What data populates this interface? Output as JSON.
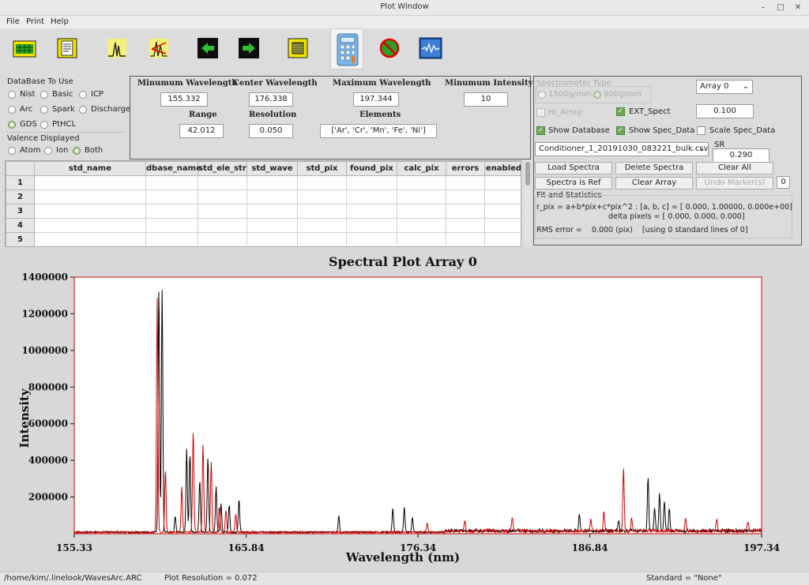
{
  "window": {
    "title": "Plot Window"
  },
  "menu": {
    "file": "File",
    "print": "Print",
    "help": "Help"
  },
  "toolbar": {
    "icons": [
      "database-icon",
      "notes-icon",
      "spectrum-peaks-icon",
      "spectrum-compare-icon",
      "arrow-left-icon",
      "arrow-right-icon",
      "square-frame-icon",
      "calculator-icon",
      "no-entry-icon",
      "waveform-monitor-icon"
    ]
  },
  "database": {
    "title": "DataBase To Use",
    "options": [
      "Nist",
      "Basic",
      "ICP",
      "Arc",
      "Spark",
      "Discharge",
      "GDS",
      "PtHCL"
    ],
    "selected": "GDS"
  },
  "valence": {
    "title": "Valence Displayed",
    "options": [
      "Atom",
      "Ion",
      "Both"
    ],
    "selected": "Both"
  },
  "params": {
    "min_wavelength_label": "Minumum Wavelength",
    "min_wavelength": "155.332",
    "center_wavelength_label": "Center Wavelength",
    "center_wavelength": "176.338",
    "max_wavelength_label": "Maximum Wavelength",
    "max_wavelength": "197.344",
    "min_intensity_label": "Minumum Intensity",
    "min_intensity": "10",
    "range_label": "Range",
    "range": "42.012",
    "resolution_label": "Resolution",
    "resolution": "0.050",
    "elements_label": "Elements",
    "elements": "['Ar', 'Cr', 'Mn', 'Fe', 'Ni']"
  },
  "table": {
    "columns": [
      "std_name",
      "dbase_name",
      "std_ele_str",
      "std_wave",
      "std_pix",
      "found_pix",
      "calc_pix",
      "errors",
      "enabled"
    ],
    "row_numbers": [
      "1",
      "2",
      "3",
      "4",
      "5"
    ]
  },
  "right_panel": {
    "spectrometer_type_label": "Spectrometer Type",
    "grating_1500": "1500g/mm",
    "grating_900": "900g/mm",
    "array_select": "Array 0",
    "hi_array": "Hi_Array:",
    "ext_spect": "EXT_Spect",
    "ext_spect_value": "0.100",
    "show_database": "Show Database",
    "show_spec_data": "Show Spec_Data",
    "scale_spec_data": "Scale Spec_Data",
    "file_select": "Conditioner_1_20191030_083221_bulk.csv",
    "sr_label": "SR",
    "sr_value": "0.290",
    "load_spectra": "Load Spectra",
    "delete_spectra": "Delete Spectra",
    "clear_all": "Clear All",
    "spectra_is_ref": "Spectra is Ref",
    "clear_array": "Clear Array",
    "undo_markers": "Undo Marker(s)",
    "marker_count": "0",
    "fit_title": "Fit and Statistics",
    "fit_equation": "r_pix = a+b*pix+c*pix^2 : [a, b, c] = [ 0.000,  1.00000, 0.000e+00]",
    "delta_pixels": "delta pixels = [  0.000,   0.000,   0.000]",
    "rms_error": "RMS error =    0.000 (pix)    [using 0 standard lines of 0]"
  },
  "chart_data": {
    "type": "line",
    "title": "Spectral Plot Array 0",
    "xlabel": "Wavelength (nm)",
    "ylabel": "Intensity",
    "xlim": [
      155.33,
      197.34
    ],
    "ylim": [
      0,
      1400000
    ],
    "xticks": [
      "155.33",
      "165.84",
      "176.34",
      "186.84",
      "197.34"
    ],
    "yticks": [
      "200000",
      "400000",
      "600000",
      "800000",
      "1000000",
      "1200000",
      "1400000"
    ],
    "series": [
      {
        "color": "#000000",
        "peaks": [
          [
            160.5,
            1340000
          ],
          [
            160.7,
            1320000
          ],
          [
            161.5,
            90000
          ],
          [
            162.2,
            460000
          ],
          [
            162.4,
            430000
          ],
          [
            163.0,
            280000
          ],
          [
            163.5,
            410000
          ],
          [
            164.0,
            250000
          ],
          [
            164.3,
            160000
          ],
          [
            164.8,
            150000
          ],
          [
            165.4,
            180000
          ],
          [
            171.5,
            90000
          ],
          [
            174.8,
            130000
          ],
          [
            175.5,
            140000
          ],
          [
            176.0,
            80000
          ],
          [
            186.2,
            90000
          ],
          [
            188.6,
            60000
          ],
          [
            190.4,
            290000
          ],
          [
            190.8,
            120000
          ],
          [
            191.1,
            200000
          ],
          [
            191.4,
            160000
          ],
          [
            191.7,
            130000
          ]
        ]
      },
      {
        "color": "#d40000",
        "peaks": [
          [
            160.4,
            1280000
          ],
          [
            160.9,
            340000
          ],
          [
            161.9,
            250000
          ],
          [
            162.6,
            550000
          ],
          [
            163.2,
            480000
          ],
          [
            163.7,
            380000
          ],
          [
            164.2,
            140000
          ],
          [
            164.6,
            120000
          ],
          [
            165.2,
            100000
          ],
          [
            176.9,
            50000
          ],
          [
            179.2,
            60000
          ],
          [
            182.1,
            70000
          ],
          [
            186.9,
            60000
          ],
          [
            187.7,
            110000
          ],
          [
            188.9,
            340000
          ],
          [
            189.4,
            70000
          ],
          [
            192.7,
            70000
          ],
          [
            194.6,
            60000
          ],
          [
            196.5,
            50000
          ]
        ]
      }
    ]
  },
  "status": {
    "path": "/home/kim/.linelook/WavesArc.ARC",
    "plot_resolution": "Plot Resolution = 0.072",
    "standard": "Standard = \"None\""
  }
}
